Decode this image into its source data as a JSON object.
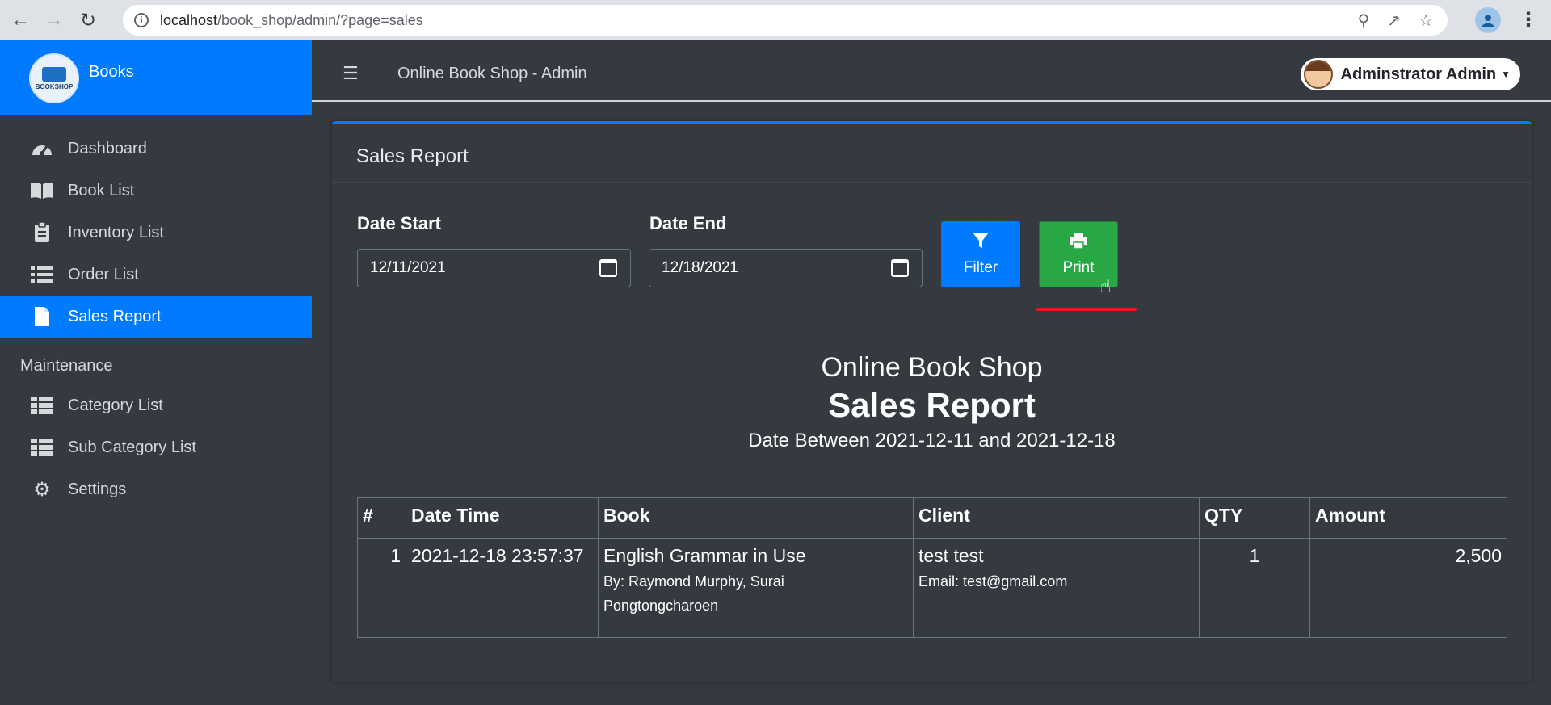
{
  "browser": {
    "url_host": "localhost",
    "url_path": "/book_shop/admin/?page=sales"
  },
  "sidebar": {
    "brand_name": "Books",
    "logo_text": "BOOKSHOP",
    "items": [
      {
        "label": "Dashboard",
        "icon": "tachometer-icon"
      },
      {
        "label": "Book List",
        "icon": "book-icon"
      },
      {
        "label": "Inventory List",
        "icon": "clipboard-icon"
      },
      {
        "label": "Order List",
        "icon": "list-icon"
      },
      {
        "label": "Sales Report",
        "icon": "file-icon",
        "active": true
      }
    ],
    "maintenance_header": "Maintenance",
    "maintenance_items": [
      {
        "label": "Category List",
        "icon": "table-list-icon"
      },
      {
        "label": "Sub Category List",
        "icon": "table-list-icon"
      },
      {
        "label": "Settings",
        "icon": "cogs-icon"
      }
    ]
  },
  "topbar": {
    "title": "Online Book Shop - Admin",
    "user_name": "Adminstrator Admin"
  },
  "card": {
    "title": "Sales Report",
    "date_start_label": "Date Start",
    "date_start_value": "12/11/2021",
    "date_end_label": "Date End",
    "date_end_value": "12/18/2021",
    "filter_label": "Filter",
    "print_label": "Print"
  },
  "report": {
    "shop_name": "Online Book Shop",
    "title": "Sales Report",
    "range": "Date Between 2021-12-11 and 2021-12-18"
  },
  "table": {
    "headers": [
      "#",
      "Date Time",
      "Book",
      "Client",
      "QTY",
      "Amount"
    ],
    "rows": [
      {
        "num": "1",
        "datetime": "2021-12-18 23:57:37",
        "book_title": "English Grammar in Use",
        "book_by": "By: Raymond Murphy, Surai",
        "book_by2": "Pongtongcharoen",
        "client_name": "test test",
        "client_email": "Email: test@gmail.com",
        "qty": "1",
        "amount": "2,500"
      }
    ]
  },
  "colors": {
    "accent": "#007bff",
    "print": "#28a745",
    "background": "#343a40"
  }
}
